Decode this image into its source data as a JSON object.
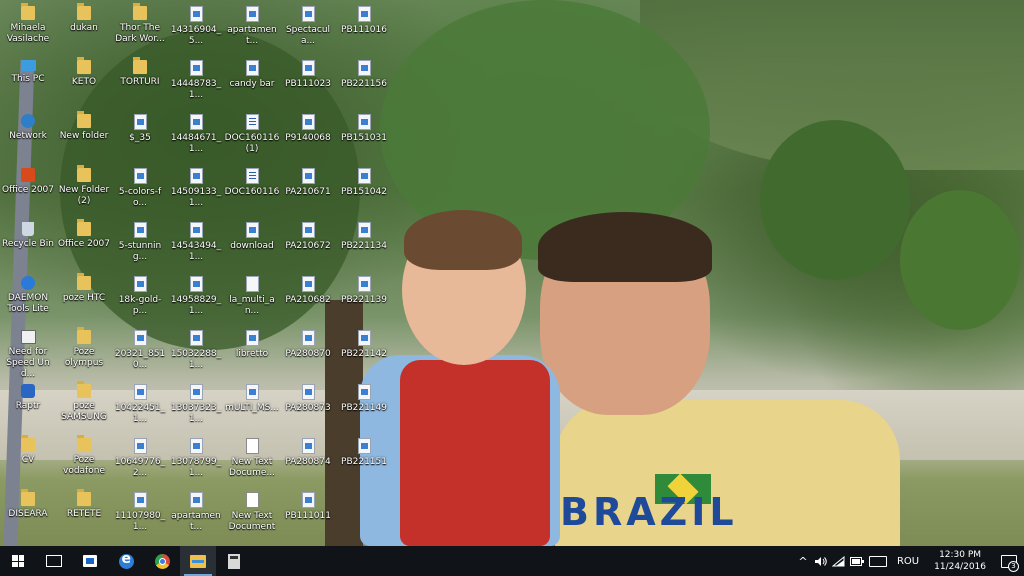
{
  "desktop": {
    "columns": [
      [
        {
          "label": "Mihaela\nVasilache",
          "icon": "folder"
        },
        {
          "label": "This PC",
          "icon": "this-pc"
        },
        {
          "label": "Network",
          "icon": "network"
        },
        {
          "label": "Office 2007",
          "icon": "office"
        },
        {
          "label": "Recycle Bin",
          "icon": "recycle-bin"
        },
        {
          "label": "DAEMON\nTools Lite",
          "icon": "daemon-tools"
        },
        {
          "label": "Need for\nSpeed Und...",
          "icon": "app"
        },
        {
          "label": "Raptr",
          "icon": "raptr"
        },
        {
          "label": "CV",
          "icon": "folder"
        },
        {
          "label": "DISEARA",
          "icon": "folder"
        }
      ],
      [
        {
          "label": "dukan",
          "icon": "folder"
        },
        {
          "label": "KETO",
          "icon": "folder"
        },
        {
          "label": "New folder",
          "icon": "folder"
        },
        {
          "label": "New Folder\n(2)",
          "icon": "folder"
        },
        {
          "label": "Office 2007",
          "icon": "folder"
        },
        {
          "label": "poze HTC",
          "icon": "folder"
        },
        {
          "label": "Poze\nolympus",
          "icon": "folder"
        },
        {
          "label": "poze\nSAMSUNG",
          "icon": "folder"
        },
        {
          "label": "Poze\nvodafone",
          "icon": "folder"
        },
        {
          "label": "RETETE",
          "icon": "folder"
        }
      ],
      [
        {
          "label": "Thor The\nDark Wor...",
          "icon": "folder"
        },
        {
          "label": "TORTURI",
          "icon": "folder"
        },
        {
          "label": "$_35",
          "icon": "image"
        },
        {
          "label": "5-colors-fo...",
          "icon": "image"
        },
        {
          "label": "5-stunning...",
          "icon": "image"
        },
        {
          "label": "18k-gold-p...",
          "icon": "image"
        },
        {
          "label": "20321_8510...",
          "icon": "image"
        },
        {
          "label": "10422451_1...",
          "icon": "image"
        },
        {
          "label": "10649776_2...",
          "icon": "image"
        },
        {
          "label": "11107980_1...",
          "icon": "image"
        }
      ],
      [
        {
          "label": "14316904_5...",
          "icon": "image"
        },
        {
          "label": "14448783_1...",
          "icon": "image"
        },
        {
          "label": "14484671_1...",
          "icon": "image"
        },
        {
          "label": "14509133_1...",
          "icon": "image"
        },
        {
          "label": "14543494_1...",
          "icon": "image"
        },
        {
          "label": "14958829_1...",
          "icon": "image"
        },
        {
          "label": "15032288_1...",
          "icon": "image"
        },
        {
          "label": "13037323_1...",
          "icon": "image"
        },
        {
          "label": "13078799_1...",
          "icon": "image"
        },
        {
          "label": "apartament...",
          "icon": "image"
        }
      ],
      [
        {
          "label": "apartament...",
          "icon": "image"
        },
        {
          "label": "candy bar",
          "icon": "image"
        },
        {
          "label": "DOC160116\n(1)",
          "icon": "document"
        },
        {
          "label": "DOC160116",
          "icon": "document"
        },
        {
          "label": "download",
          "icon": "image"
        },
        {
          "label": "la_multi_an...",
          "icon": "file"
        },
        {
          "label": "libretto",
          "icon": "image"
        },
        {
          "label": "mULTI_MS...",
          "icon": "image"
        },
        {
          "label": "New Text\nDocume...",
          "icon": "text-file"
        },
        {
          "label": "New Text\nDocument",
          "icon": "text-file"
        }
      ],
      [
        {
          "label": "Spectacula...",
          "icon": "image"
        },
        {
          "label": "PB111023",
          "icon": "image"
        },
        {
          "label": "P9140068",
          "icon": "image"
        },
        {
          "label": "PA210671",
          "icon": "image"
        },
        {
          "label": "PA210672",
          "icon": "image"
        },
        {
          "label": "PA210682",
          "icon": "image"
        },
        {
          "label": "PA280870",
          "icon": "image"
        },
        {
          "label": "PA280873",
          "icon": "image"
        },
        {
          "label": "PA280874",
          "icon": "image"
        },
        {
          "label": "PB111011",
          "icon": "image"
        }
      ],
      [
        {
          "label": "PB111016",
          "icon": "image"
        },
        {
          "label": "PB221156",
          "icon": "image"
        },
        {
          "label": "PB151031",
          "icon": "image"
        },
        {
          "label": "PB151042",
          "icon": "image"
        },
        {
          "label": "PB221134",
          "icon": "image"
        },
        {
          "label": "PB221139",
          "icon": "image"
        },
        {
          "label": "PB221142",
          "icon": "image"
        },
        {
          "label": "PB221149",
          "icon": "image"
        },
        {
          "label": "PB221151",
          "icon": "image"
        }
      ]
    ]
  },
  "wallpaper": {
    "shirt_text": "BRAZIL"
  },
  "taskbar": {
    "pinned": [
      {
        "name": "start",
        "icon": "windows-logo"
      },
      {
        "name": "task-view",
        "icon": "task-view"
      },
      {
        "name": "store",
        "icon": "store-bag"
      },
      {
        "name": "edge",
        "icon": "edge-e"
      },
      {
        "name": "chrome",
        "icon": "chrome"
      },
      {
        "name": "file-explorer",
        "icon": "folder",
        "active": true
      },
      {
        "name": "calculator",
        "icon": "calculator"
      }
    ],
    "tray": {
      "chevron": "^",
      "language": "ROU",
      "time": "12:30 PM",
      "date": "11/24/2016",
      "notification_count": "3"
    }
  }
}
